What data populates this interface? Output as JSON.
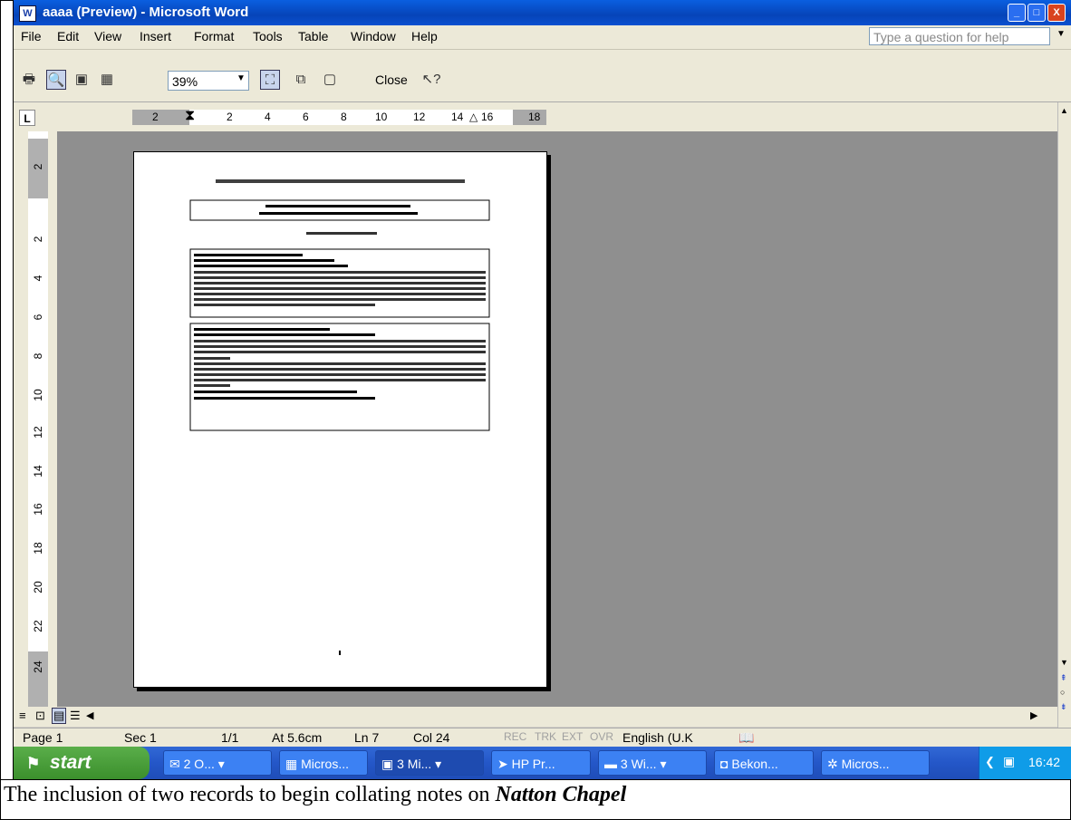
{
  "window": {
    "title": "aaaa (Preview) - Microsoft Word",
    "app_icon": "W",
    "controls": [
      "_",
      "□",
      "X"
    ]
  },
  "menu": {
    "items": [
      "File",
      "Edit",
      "View",
      "Insert",
      "Format",
      "Tools",
      "Table",
      "Window",
      "Help"
    ],
    "help_placeholder": "Type a question for help"
  },
  "toolbar": {
    "zoom": "39%",
    "close_label": "Close"
  },
  "ruler": {
    "tab_selector": "L",
    "h_labels": [
      "2",
      "2",
      "4",
      "6",
      "8",
      "10",
      "12",
      "14",
      "16",
      "18"
    ],
    "v_labels": [
      "2",
      "2",
      "4",
      "6",
      "8",
      "10",
      "12",
      "14",
      "16",
      "18",
      "20",
      "22",
      "24"
    ]
  },
  "status": {
    "page": "Page 1",
    "sec": "Sec 1",
    "pages": "1/1",
    "at": "At 5.6cm",
    "ln": "Ln 7",
    "col": "Col 24",
    "rec": "REC",
    "trk": "TRK",
    "ext": "EXT",
    "ovr": "OVR",
    "lang": "English (U.K"
  },
  "taskbar": {
    "start_label": "start",
    "tasks": [
      "2 O...",
      "Micros...",
      "3 Mi...",
      "HP Pr...",
      "3 Wi...",
      "Bekon...",
      "Micros..."
    ],
    "clock": "16:42"
  },
  "caption": {
    "text": "The inclusion of two records to begin collating notes on ",
    "bold": "Natton Chapel"
  }
}
